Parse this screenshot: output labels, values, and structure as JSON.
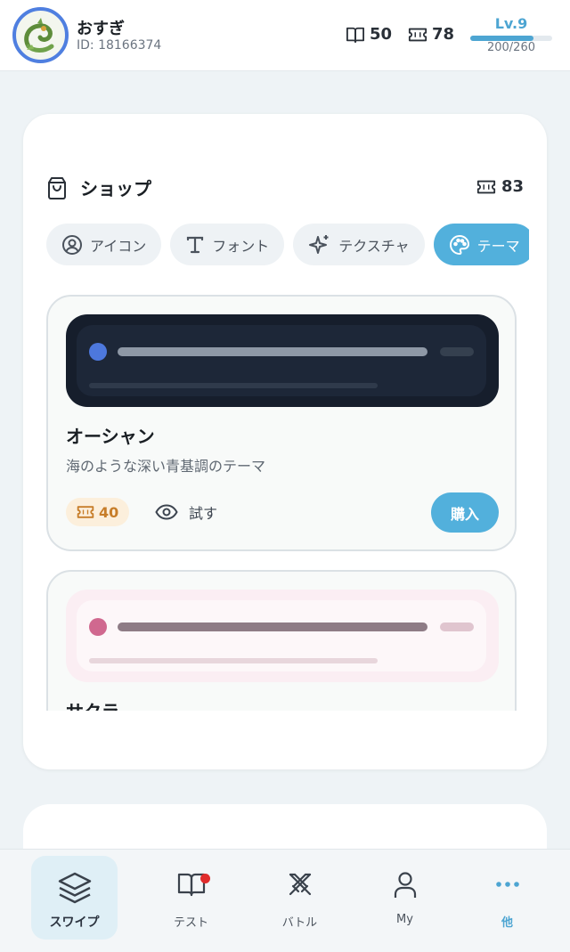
{
  "header": {
    "user_name": "おすぎ",
    "user_id": "ID: 18166374",
    "books_count": "50",
    "tickets_count": "78",
    "level_label": "Lv.9",
    "level_xp": "200/260",
    "level_progress": 0.77
  },
  "shop": {
    "title": "ショップ",
    "balance": "83",
    "tabs": [
      {
        "label": "アイコン",
        "icon": "user-circle-icon"
      },
      {
        "label": "フォント",
        "icon": "text-icon"
      },
      {
        "label": "テクスチャ",
        "icon": "sparkles-icon"
      },
      {
        "label": "テーマ",
        "icon": "palette-icon",
        "active": true
      }
    ],
    "items": [
      {
        "name": "オーシャン",
        "description": "海のような深い青基調のテーマ",
        "price": "40",
        "try_label": "試す",
        "buy_label": "購入"
      },
      {
        "name": "サクラ"
      }
    ]
  },
  "nav": {
    "items": [
      {
        "label": "スワイプ",
        "icon": "layers-icon",
        "active": true
      },
      {
        "label": "テスト",
        "icon": "book-open-icon",
        "notification": true
      },
      {
        "label": "バトル",
        "icon": "swords-icon"
      },
      {
        "label": "My",
        "icon": "user-icon"
      },
      {
        "label": "他",
        "icon": "more-dots-icon"
      }
    ]
  },
  "colors": {
    "accent": "#52b0dc",
    "level_accent": "#4da5d2",
    "price_badge_bg": "#fcefdc",
    "price_text": "#c77d29",
    "notification": "#e02c2c"
  }
}
